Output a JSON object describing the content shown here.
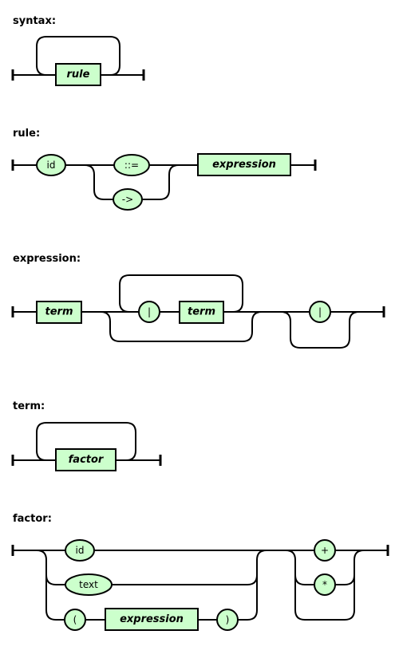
{
  "diagram": {
    "type": "railroad-syntax-diagram",
    "colors": {
      "node_fill": "#ccffcc",
      "stroke": "#000000",
      "background": "#ffffff"
    },
    "rules": [
      {
        "name": "syntax",
        "label": "syntax:",
        "nonterminals": [
          "rule"
        ],
        "terminals": [],
        "structure": "one-or-more(rule)"
      },
      {
        "name": "rule",
        "label": "rule:",
        "nonterminals": [
          "expression"
        ],
        "terminals": [
          "id",
          "::=",
          "->"
        ],
        "structure": "sequence(id, choice('::=', '->'), expression)"
      },
      {
        "name": "expression",
        "label": "expression:",
        "nonterminals": [
          "term",
          "term"
        ],
        "terminals": [
          "|",
          "|"
        ],
        "structure": "sequence(term, zero-or-more('|' term), optional('|'))"
      },
      {
        "name": "term",
        "label": "term:",
        "nonterminals": [
          "factor"
        ],
        "terminals": [],
        "structure": "one-or-more(factor)"
      },
      {
        "name": "factor",
        "label": "factor:",
        "nonterminals": [
          "expression"
        ],
        "terminals": [
          "id",
          "text",
          "(",
          ")",
          "+",
          "*"
        ],
        "structure": "sequence(choice(id, text, sequence('(', expression, ')')), optional(choice('+', '*')))"
      }
    ]
  }
}
